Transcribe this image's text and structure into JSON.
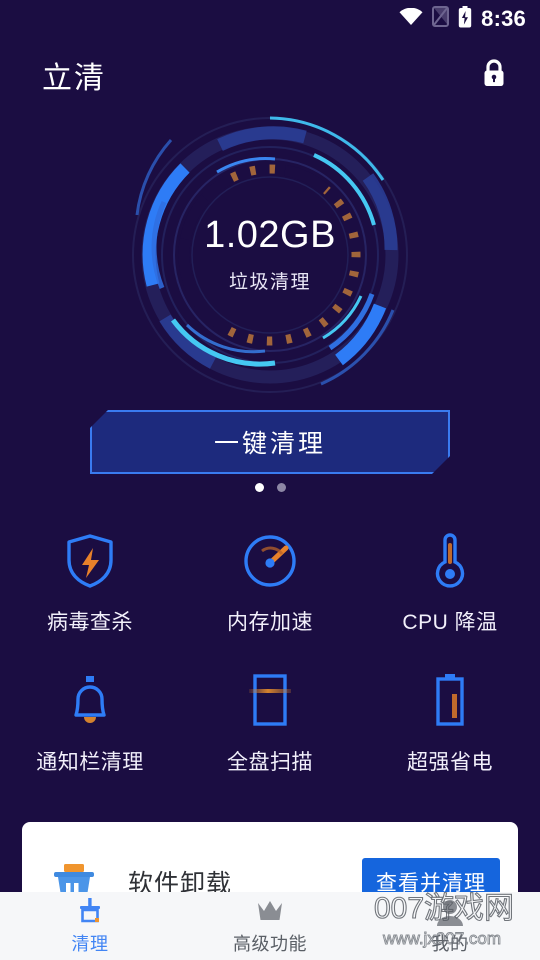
{
  "statusbar": {
    "time": "8:36",
    "icons": [
      "wifi-icon",
      "sim-card-icon",
      "battery-charging-icon"
    ]
  },
  "header": {
    "title": "立清",
    "lock_icon": "lock-icon"
  },
  "gauge": {
    "value": "1.02GB",
    "label": "垃圾清理",
    "arc_color": "#2e7cf6",
    "arc_cyan": "#36c6f0",
    "track_color": "#2a2a6e",
    "tick_color": "#b8763a"
  },
  "primary_action": {
    "label": "一键清理",
    "fill": "#1d2a7d",
    "border": "#3a7bf0"
  },
  "pager": {
    "total": 2,
    "active_index": 0,
    "active_color": "#ffffff",
    "inactive_color": "#8d87a5"
  },
  "features": [
    {
      "label": "病毒查杀",
      "icon": "shield-bolt-icon"
    },
    {
      "label": "内存加速",
      "icon": "speedometer-icon"
    },
    {
      "label": "CPU 降温",
      "icon": "thermometer-icon"
    },
    {
      "label": "通知栏清理",
      "icon": "bell-icon"
    },
    {
      "label": "全盘扫描",
      "icon": "scan-frame-icon"
    },
    {
      "label": "超强省电",
      "icon": "battery-icon"
    }
  ],
  "card": {
    "icon": "trash-bin-icon",
    "title": "软件卸载",
    "button_label": "查看并清理",
    "button_color": "#1565dd"
  },
  "bottom_nav": {
    "active_color": "#4285f4",
    "inactive_color": "#5a5f66",
    "items": [
      {
        "label": "清理",
        "icon": "broom-icon",
        "active": true
      },
      {
        "label": "高级功能",
        "icon": "crown-icon",
        "active": false
      },
      {
        "label": "我的",
        "icon": "person-icon",
        "active": false
      }
    ]
  },
  "watermark": {
    "line1": "007游戏网",
    "line2": "www.jx007.com"
  }
}
